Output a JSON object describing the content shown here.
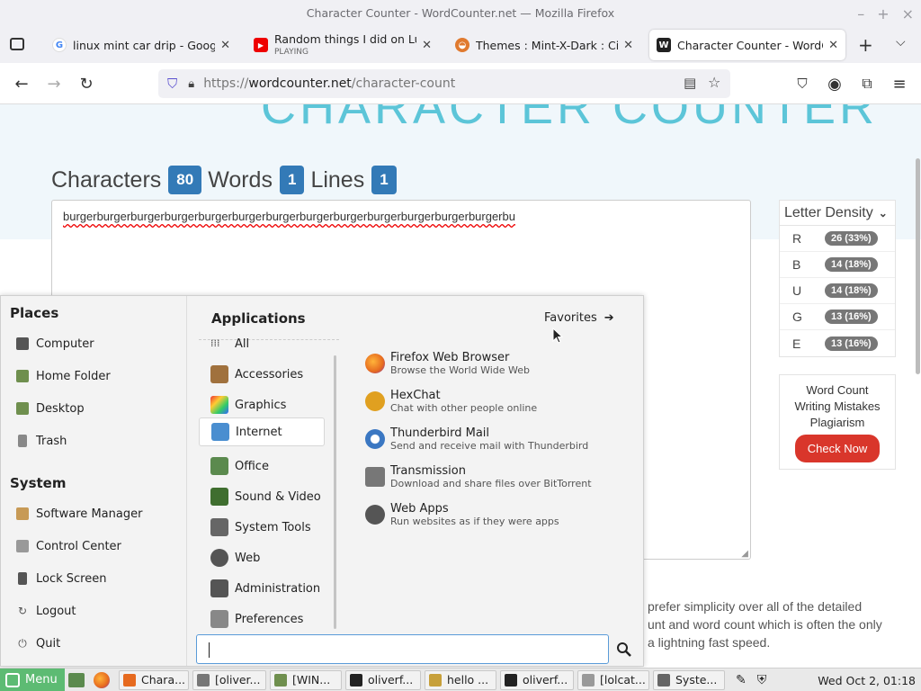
{
  "window": {
    "title": "Character Counter - WordCounter.net — Mozilla Firefox",
    "controls": [
      "–",
      "+",
      "×"
    ]
  },
  "tabs": [
    {
      "label": "linux mint car drip - Google S",
      "icon": "google-icon",
      "color": "#4285f4",
      "glyph": "G"
    },
    {
      "label": "Random things I did on Lum",
      "sub": "PLAYING",
      "icon": "youtube-icon",
      "color": "#e00",
      "glyph": "▶"
    },
    {
      "label": "Themes : Mint-X-Dark : Cinna",
      "icon": "cinnamon-icon",
      "color": "#e07a2f",
      "glyph": "◒"
    },
    {
      "label": "Character Counter - WordCo",
      "icon": "wordcounter-icon",
      "color": "#222",
      "glyph": "W"
    }
  ],
  "url": {
    "scheme": "https://",
    "host": "wordcounter.net",
    "path": "/character-count"
  },
  "page": {
    "banner_title": "CHARACTER COUNTER",
    "characters_label": "Characters",
    "characters": "80",
    "words_label": "Words",
    "words": "1",
    "lines_label": "Lines",
    "lines": "1",
    "text": "burgerburgerburgerburgerburgerburgerburgerburgerburgerburgerburgerburgerburgerbu",
    "density_title": "Letter Density",
    "density": [
      {
        "letter": "R",
        "value": "26 (33%)"
      },
      {
        "letter": "B",
        "value": "14 (18%)"
      },
      {
        "letter": "U",
        "value": "14 (18%)"
      },
      {
        "letter": "G",
        "value": "13 (16%)"
      },
      {
        "letter": "E",
        "value": "13 (16%)"
      }
    ],
    "ad_lines": [
      "Word Count",
      "Writing Mistakes",
      "Plagiarism"
    ],
    "ad_button": "Check Now",
    "desc_lines": [
      "prefer simplicity over all of the detailed",
      "unt and word count which is often the only",
      "a lightning fast speed."
    ]
  },
  "menu": {
    "places_title": "Places",
    "places": [
      {
        "label": "Computer",
        "icon": "computer-icon",
        "color": "#555"
      },
      {
        "label": "Home Folder",
        "icon": "home-folder-icon",
        "color": "#6f8f4e"
      },
      {
        "label": "Desktop",
        "icon": "desktop-icon",
        "color": "#6f8f4e"
      },
      {
        "label": "Trash",
        "icon": "trash-icon",
        "color": "#888"
      }
    ],
    "system_title": "System",
    "system": [
      {
        "label": "Software Manager",
        "icon": "software-manager-icon",
        "color": "#c79a56"
      },
      {
        "label": "Control Center",
        "icon": "control-center-icon",
        "color": "#777"
      },
      {
        "label": "Lock Screen",
        "icon": "lock-screen-icon",
        "color": "#555"
      },
      {
        "label": "Logout",
        "icon": "logout-icon",
        "color": "#555"
      },
      {
        "label": "Quit",
        "icon": "quit-icon",
        "color": "#555"
      }
    ],
    "apps_title": "Applications",
    "favorites": "Favorites",
    "categories": [
      {
        "label": "All",
        "icon": "all-icon",
        "color": "#444"
      },
      {
        "label": "Accessories",
        "icon": "accessories-icon",
        "color": "#a0713d"
      },
      {
        "label": "Graphics",
        "icon": "graphics-icon",
        "color": "#d54c8a"
      },
      {
        "label": "Internet",
        "icon": "internet-icon",
        "color": "#4a8ed0"
      },
      {
        "label": "Office",
        "icon": "office-icon",
        "color": "#5b8a4e"
      },
      {
        "label": "Sound & Video",
        "icon": "sound-video-icon",
        "color": "#3f6e2f"
      },
      {
        "label": "System Tools",
        "icon": "system-tools-icon",
        "color": "#666"
      },
      {
        "label": "Web",
        "icon": "web-icon",
        "color": "#555"
      },
      {
        "label": "Administration",
        "icon": "administration-icon",
        "color": "#555"
      },
      {
        "label": "Preferences",
        "icon": "preferences-icon",
        "color": "#777"
      }
    ],
    "apps": [
      {
        "name": "Firefox Web Browser",
        "desc": "Browse the World Wide Web",
        "icon": "firefox-icon",
        "color": "#e66a1f"
      },
      {
        "name": "HexChat",
        "desc": "Chat with other people online",
        "icon": "hexchat-icon",
        "color": "#e0a020"
      },
      {
        "name": "Thunderbird Mail",
        "desc": "Send and receive mail with Thunderbird",
        "icon": "thunderbird-icon",
        "color": "#3a77c2"
      },
      {
        "name": "Transmission",
        "desc": "Download and share files over BitTorrent",
        "icon": "transmission-icon",
        "color": "#777"
      },
      {
        "name": "Web Apps",
        "desc": "Run websites as if they were apps",
        "icon": "web-apps-icon",
        "color": "#555"
      }
    ],
    "search_value": ""
  },
  "panel": {
    "menu_label": "Menu",
    "buttons": [
      {
        "label": "Chara...",
        "icon": "firefox-icon",
        "color": "#e66a1f"
      },
      {
        "label": "[oliver...",
        "icon": "terminal-icon",
        "color": "#777"
      },
      {
        "label": "[WIN...",
        "icon": "folder-icon",
        "color": "#6f8f4e"
      },
      {
        "label": "oliverf...",
        "icon": "terminal-icon",
        "color": "#222"
      },
      {
        "label": "hello ...",
        "icon": "text-editor-icon",
        "color": "#c7a03a"
      },
      {
        "label": "oliverf...",
        "icon": "terminal-icon",
        "color": "#222"
      },
      {
        "label": "[lolcat...",
        "icon": "image-icon",
        "color": "#999"
      },
      {
        "label": "Syste...",
        "icon": "system-monitor-icon",
        "color": "#666"
      }
    ],
    "clock": "Wed Oct  2, 01:18"
  }
}
